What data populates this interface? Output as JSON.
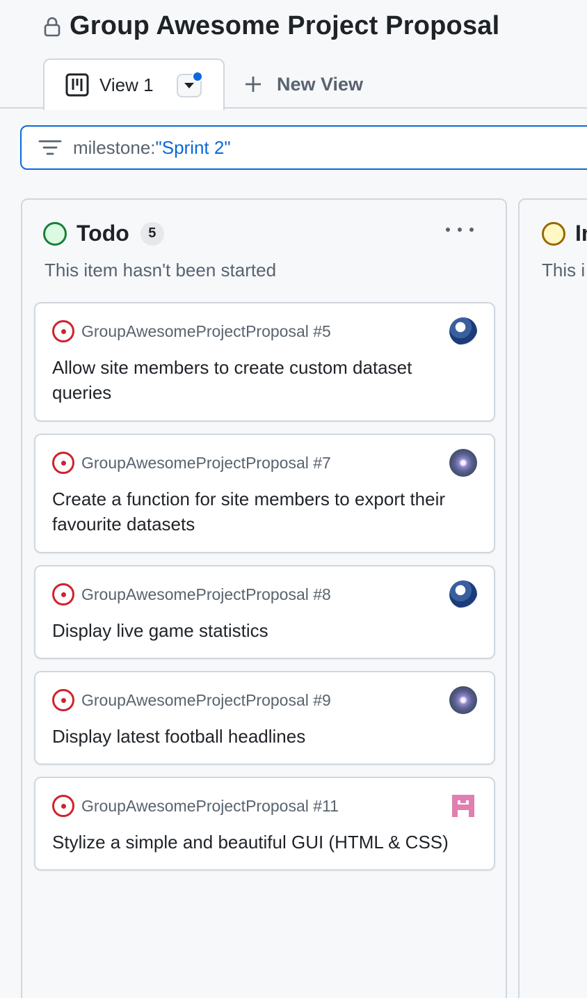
{
  "project": {
    "title": "Group Awesome Project Proposal"
  },
  "tabs": {
    "active_label": "View 1",
    "new_view_label": "New View"
  },
  "filter": {
    "key": "milestone:",
    "value": "\"Sprint 2\""
  },
  "columns": [
    {
      "title": "Todo",
      "count": "5",
      "description": "This item hasn't been started",
      "status_color": "#1a7f37",
      "cards": [
        {
          "repo": "GroupAwesomeProjectProposal #5",
          "title": "Allow site members to create custom dataset queries",
          "avatar": "wave-avatar"
        },
        {
          "repo": "GroupAwesomeProjectProposal #7",
          "title": "Create a function for site members to export their favourite datasets",
          "avatar": "galaxy-avatar"
        },
        {
          "repo": "GroupAwesomeProjectProposal #8",
          "title": "Display live game statistics",
          "avatar": "wave-avatar"
        },
        {
          "repo": "GroupAwesomeProjectProposal #9",
          "title": "Display latest football headlines",
          "avatar": "galaxy-avatar"
        },
        {
          "repo": "GroupAwesomeProjectProposal #11",
          "title": "Stylize a simple and beautiful GUI (HTML & CSS)",
          "avatar": "pink-identicon-avatar"
        }
      ]
    },
    {
      "title": "In",
      "description": "This i",
      "status_color": "#9a6700"
    }
  ],
  "colors": {
    "accent": "#0969da",
    "issue_open": "#cf222e",
    "border": "#d0d7de"
  }
}
